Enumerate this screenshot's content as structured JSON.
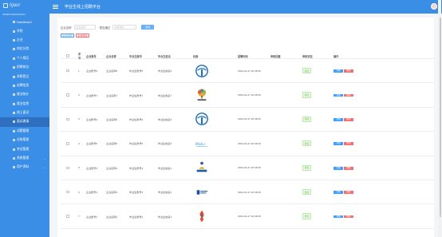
{
  "app": {
    "logo_text": "hjaor",
    "subtitle": "ADMIN NAVIGATION",
    "brand_title": "毕业生线上招聘平台"
  },
  "sidebar": {
    "items": [
      {
        "label": "Dashboard",
        "icon": "dashboard-icon",
        "active": false
      },
      {
        "label": "学院",
        "icon": "heart-icon",
        "active": false
      },
      {
        "label": "企业",
        "icon": "user-icon",
        "active": false
      },
      {
        "label": "岗位分类",
        "icon": "grid-icon",
        "active": false
      },
      {
        "label": "个人简历",
        "icon": "resume-icon",
        "active": false
      },
      {
        "label": "招聘岗位",
        "icon": "star-icon",
        "active": false
      },
      {
        "label": "求职登记",
        "icon": "list-icon",
        "active": false
      },
      {
        "label": "应聘信息",
        "icon": "mail-icon",
        "active": false
      },
      {
        "label": "就业统计",
        "icon": "chart-icon",
        "active": false
      },
      {
        "label": "就业信息",
        "icon": "info-icon",
        "active": false
      },
      {
        "label": "线上面试",
        "icon": "video-icon",
        "active": false
      },
      {
        "label": "面试邀请",
        "icon": "calendar-icon",
        "active": true
      },
      {
        "label": "试题管理",
        "icon": "book-icon",
        "active": false
      },
      {
        "label": "试卷管理",
        "icon": "paper-icon",
        "active": false
      },
      {
        "label": "考试管理",
        "icon": "exam-icon",
        "active": false
      },
      {
        "label": "系统管理",
        "icon": "gear-icon",
        "active": false,
        "has_caret": true
      },
      {
        "label": "用户资料",
        "icon": "profile-icon",
        "active": false,
        "has_caret": true
      }
    ]
  },
  "filters": {
    "company_label": "企业名称",
    "company_placeholder": "企业名称",
    "status_label": "是否通过",
    "status_placeholder": "是否通过",
    "search_button": "查询"
  },
  "actions": {
    "add_label": "新增招聘",
    "delete_label": "批量删除"
  },
  "table": {
    "headers": {
      "index": "序号",
      "company_no": "企业账号",
      "company_name": "企业名称",
      "grad_no": "毕业生账号",
      "grad_name": "毕业生姓名",
      "image": "封面",
      "time": "招聘时间",
      "reply": "审核回复",
      "state": "审核状态",
      "op": "操作"
    },
    "rows": [
      {
        "index": "1",
        "company_no": "企业账号8",
        "company_name": "企业名称8",
        "grad_no": "毕业生账号8",
        "grad_name": "毕业生姓名8",
        "logo": "logo-blue-t",
        "time": "2024-01-27 18:48:30",
        "reply": "",
        "state": "通过",
        "edit": "详情",
        "del": "删除"
      },
      {
        "index": "2",
        "company_no": "企业账号7",
        "company_name": "企业名称7",
        "grad_no": "毕业生账号7",
        "grad_name": "毕业生姓名7",
        "logo": "logo-tree",
        "time": "2024-01-27 18:48:30",
        "reply": "",
        "state": "通过",
        "edit": "详情",
        "del": "删除"
      },
      {
        "index": "3",
        "company_no": "企业账号6",
        "company_name": "企业名称6",
        "grad_no": "毕业生账号6",
        "grad_name": "毕业生姓名6",
        "logo": "logo-blue-t",
        "time": "2024-01-27 18:48:30",
        "reply": "",
        "state": "通过",
        "edit": "详情",
        "del": "删除"
      },
      {
        "index": "4",
        "company_no": "企业账号5",
        "company_name": "企业名称5",
        "grad_no": "毕业生账号5",
        "grad_name": "毕业生姓名5",
        "logo": "logo-text-blue",
        "time": "2024-01-27 18:48:30",
        "reply": "",
        "state": "通过",
        "edit": "详情",
        "del": "删除"
      },
      {
        "index": "5",
        "company_no": "企业账号4",
        "company_name": "企业名称4",
        "grad_no": "毕业生账号4",
        "grad_name": "毕业生姓名4",
        "logo": "logo-figure",
        "time": "2024-01-27 18:48:30",
        "reply": "",
        "state": "通过",
        "edit": "详情",
        "del": "删除"
      },
      {
        "index": "6",
        "company_no": "企业账号3",
        "company_name": "企业名称3",
        "grad_no": "毕业生账号3",
        "grad_name": "毕业生姓名3",
        "logo": "logo-shield",
        "time": "2024-01-27 18:48:30",
        "reply": "",
        "state": "通过",
        "edit": "详情",
        "del": "删除"
      },
      {
        "index": "7",
        "company_no": "企业账号2",
        "company_name": "企业名称2",
        "grad_no": "毕业生账号2",
        "grad_name": "毕业生姓名2",
        "logo": "logo-flame",
        "time": "2024-01-27 18:48:30",
        "reply": "",
        "state": "通过",
        "edit": "详情",
        "del": "删除"
      }
    ]
  },
  "colors": {
    "sidebar": "#3a8ee6",
    "active": "#2f6fc0",
    "edit": "#409eff",
    "delete": "#f56c6c",
    "pass": "#67c23a"
  }
}
